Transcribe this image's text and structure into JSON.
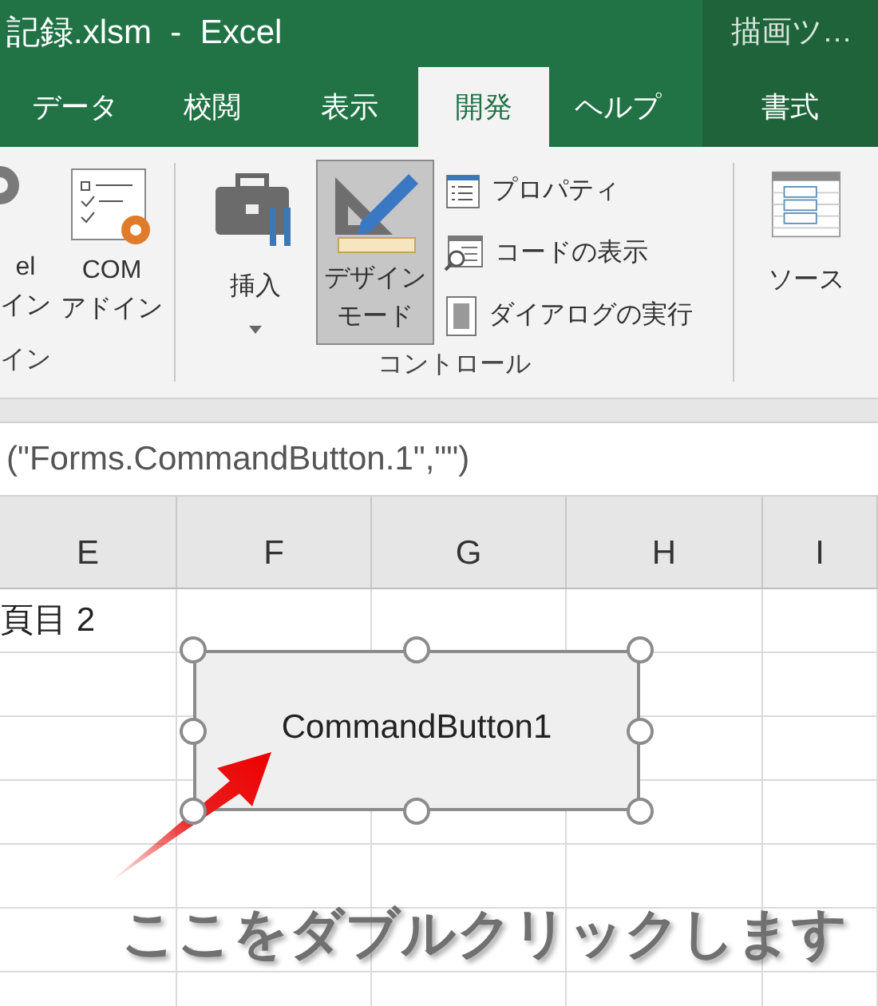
{
  "window": {
    "title": "記録.xlsm  -  Excel",
    "context_label": "描画ツ…"
  },
  "tabs": [
    {
      "label": "データ",
      "selected": false
    },
    {
      "label": "校閲",
      "selected": false
    },
    {
      "label": "表示",
      "selected": false
    },
    {
      "label": "開発",
      "selected": true
    },
    {
      "label": "ヘルプ",
      "selected": false
    },
    {
      "label": "書式",
      "selected": false
    }
  ],
  "ribbon": {
    "addin_group": {
      "label": "イン",
      "buttons": [
        {
          "lines": [
            "el",
            "イン"
          ]
        },
        {
          "lines": [
            "COM",
            "アドイン"
          ]
        }
      ]
    },
    "controls_group": {
      "label": "コントロール",
      "insert": {
        "label": "挿入"
      },
      "design_mode": {
        "lines": [
          "デザイン",
          "モード"
        ],
        "selected": true
      },
      "small_buttons": [
        {
          "label": "プロパティ"
        },
        {
          "label": "コードの表示"
        },
        {
          "label": "ダイアログの実行"
        }
      ]
    },
    "xml_group": {
      "source": {
        "label": "ソース"
      }
    }
  },
  "formula_bar": {
    "value": "(\"Forms.CommandButton.1\",\"\")"
  },
  "sheet": {
    "columns": [
      "E",
      "F",
      "G",
      "H",
      "I"
    ],
    "rows": [
      [
        "頁目 2"
      ]
    ],
    "command_button": {
      "label": "CommandButton1",
      "selected": true
    },
    "annotation": {
      "text": "ここをダブルクリックします"
    }
  }
}
